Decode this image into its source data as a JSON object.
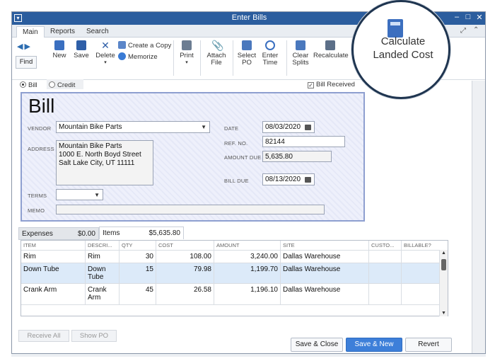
{
  "window": {
    "title": "Enter Bills"
  },
  "menu_tabs": [
    {
      "label": "Main",
      "active": true
    },
    {
      "label": "Reports",
      "active": false
    },
    {
      "label": "Search",
      "active": false
    }
  ],
  "toolbar": {
    "find": "Find",
    "new": "New",
    "save": "Save",
    "delete": "Delete",
    "create_copy": "Create a Copy",
    "memorize": "Memorize",
    "print": "Print",
    "attach_file_1": "Attach",
    "attach_file_2": "File",
    "select_po_1": "Select",
    "select_po_2": "PO",
    "enter_time_1": "Enter",
    "enter_time_2": "Time",
    "clear_splits_1": "Clear",
    "clear_splits_2": "Splits",
    "recalculate": "Recalculate"
  },
  "callout": {
    "line1": "Calculate",
    "line2": "Landed Cost"
  },
  "type_options": {
    "bill": "Bill",
    "credit": "Credit",
    "bill_received": "Bill Received",
    "bill_received_checked": true
  },
  "bill": {
    "title": "Bill",
    "vendor_label": "VENDOR",
    "vendor": "Mountain Bike Parts",
    "address_label": "ADDRESS",
    "address": [
      "Mountain Bike Parts",
      "1000 E. North Boyd Street",
      "Salt Lake City, UT 11111"
    ],
    "terms_label": "TERMS",
    "terms": "",
    "memo_label": "MEMO",
    "memo": "",
    "date_label": "DATE",
    "date": "08/03/2020",
    "ref_label": "REF. NO.",
    "ref": "82144",
    "amount_due_label": "AMOUNT DUE",
    "amount_due": "5,635.80",
    "bill_due_label": "BILL DUE",
    "bill_due": "08/13/2020"
  },
  "subtabs": {
    "expenses_label": "Expenses",
    "expenses_amount": "$0.00",
    "items_label": "Items",
    "items_amount": "$5,635.80"
  },
  "items_table": {
    "headers": [
      "ITEM",
      "DESCRI...",
      "QTY",
      "COST",
      "AMOUNT",
      "SITE",
      "CUSTO...",
      "BILLABLE?"
    ],
    "rows": [
      {
        "item": "Rim",
        "desc1": "Rim",
        "desc2": "",
        "qty": "30",
        "cost": "108.00",
        "amount": "3,240.00",
        "site": "Dallas Warehouse"
      },
      {
        "item": "Down Tube",
        "desc1": "Down",
        "desc2": "Tube",
        "qty": "15",
        "cost": "79.98",
        "amount": "1,199.70",
        "site": "Dallas Warehouse"
      },
      {
        "item": "Crank Arm",
        "desc1": "Crank",
        "desc2": "Arm",
        "qty": "45",
        "cost": "26.58",
        "amount": "1,196.10",
        "site": "Dallas Warehouse"
      }
    ]
  },
  "buttons": {
    "receive_all": "Receive All",
    "show_po": "Show PO",
    "save_close": "Save & Close",
    "save_new": "Save & New",
    "revert": "Revert"
  },
  "colors": {
    "titlebar": "#2b5d9e",
    "primary_button": "#3d7fd9",
    "selected_row": "#dceaf9",
    "bill_border": "#8e9fd0"
  }
}
